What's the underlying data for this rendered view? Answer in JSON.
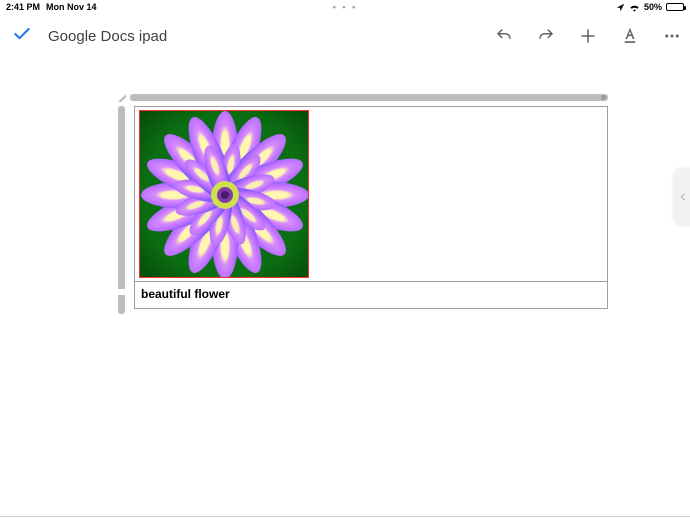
{
  "status": {
    "time": "2:41 PM",
    "date": "Mon Nov 14",
    "center_dots": "• • •",
    "battery_pct": "50%",
    "location_icon": "location-arrow",
    "wifi_icon": "wifi"
  },
  "app_bar": {
    "back_icon": "checkmark",
    "title": "Google Docs ipad",
    "tools": {
      "undo": "undo-icon",
      "redo": "redo-icon",
      "add": "plus-icon",
      "text_format": "text-format-icon",
      "more": "more-icon"
    }
  },
  "document": {
    "image_alt": "beautiful flower",
    "caption": "beautiful flower"
  },
  "side_tab": {
    "icon": "chevron-left"
  }
}
